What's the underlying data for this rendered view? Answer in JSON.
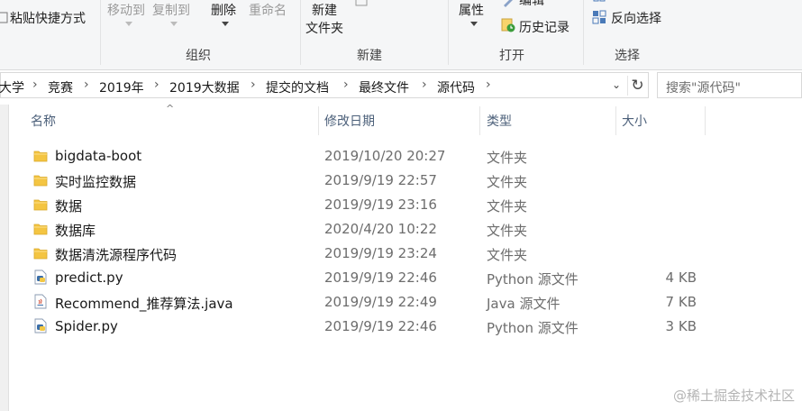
{
  "ribbon": {
    "paste_shortcut": "粘贴快捷方式",
    "move_to": "移动到",
    "copy_to": "复制到",
    "delete": "删除",
    "rename": "重命名",
    "new_folder_line1": "新建",
    "new_folder_line2": "文件夹",
    "edit_partial": "编辑",
    "properties": "属性",
    "history": "历史记录",
    "invert_selection": "反向选择",
    "groups": {
      "organize": "组织",
      "new": "新建",
      "open": "打开",
      "select": "选择"
    }
  },
  "breadcrumb": [
    "大学",
    "竞赛",
    "2019年",
    "2019大数据",
    "提交的文档",
    "最终文件",
    "源代码"
  ],
  "search": {
    "placeholder": "搜索\"源代码\""
  },
  "columns": {
    "name": "名称",
    "date": "修改日期",
    "type": "类型",
    "size": "大小"
  },
  "files": [
    {
      "name": "bigdata-boot",
      "date": "2019/10/20 20:27",
      "type": "文件夹",
      "size": "",
      "icon": "folder-icon"
    },
    {
      "name": "实时监控数据",
      "date": "2019/9/19 22:57",
      "type": "文件夹",
      "size": "",
      "icon": "folder-icon"
    },
    {
      "name": "数据",
      "date": "2019/9/19 23:16",
      "type": "文件夹",
      "size": "",
      "icon": "folder-icon"
    },
    {
      "name": "数据库",
      "date": "2020/4/20 10:22",
      "type": "文件夹",
      "size": "",
      "icon": "folder-icon"
    },
    {
      "name": "数据清洗源程序代码",
      "date": "2019/9/19 23:24",
      "type": "文件夹",
      "size": "",
      "icon": "folder-icon"
    },
    {
      "name": "predict.py",
      "date": "2019/9/19 22:46",
      "type": "Python 源文件",
      "size": "4 KB",
      "icon": "python-file-icon"
    },
    {
      "name": "Recommend_推荐算法.java",
      "date": "2019/9/19 22:49",
      "type": "Java 源文件",
      "size": "7 KB",
      "icon": "java-file-icon"
    },
    {
      "name": "Spider.py",
      "date": "2019/9/19 22:46",
      "type": "Python 源文件",
      "size": "3 KB",
      "icon": "python-file-icon"
    }
  ],
  "watermark": "@稀土掘金技术社区",
  "colors": {
    "folder": "#f4c542",
    "header_text": "#4c607a",
    "ribbon_bg": "#f5f6f7"
  }
}
